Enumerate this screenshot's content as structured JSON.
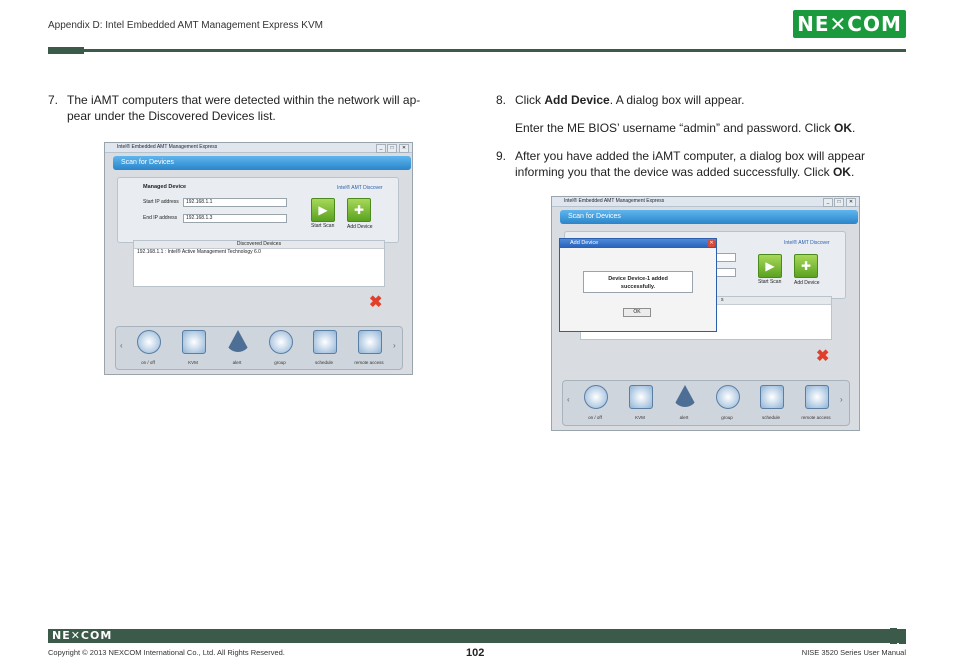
{
  "header": {
    "title": "Appendix D: Intel Embedded AMT Management Express KVM",
    "logo_text": "NE✕COM"
  },
  "steps": {
    "s7_num": "7.",
    "s7_line1": "The iAMT computers that were detected within the network will ap-",
    "s7_line2": "pear under the Discovered Devices list.",
    "s8_num": "8.",
    "s8_pre": "Click ",
    "s8_bold": "Add Device",
    "s8_post": ". A dialog box will appear.",
    "s8b_pre": "Enter the ME BIOS’ username “admin” and password. Click ",
    "s8b_bold": "OK",
    "s8b_post": ".",
    "s9_num": "9.",
    "s9_line1": "After you have added the iAMT computer, a dialog box will appear",
    "s9_line2_pre": "informing you that the device was added successfully. Click ",
    "s9_line2_bold": "OK",
    "s9_line2_post": "."
  },
  "shot1": {
    "window_title": "Intel® Embedded AMT Management Express",
    "bar_label": "Scan for Devices",
    "managed_device": "Managed Device",
    "brand": "Intel® AMT Discover",
    "start_ip_label": "Start IP address",
    "start_ip_value": "192.168.1.1",
    "end_ip_label": "End IP address",
    "end_ip_value": "192.168.1.3",
    "start_scan": "Start Scan",
    "add_device": "Add Device",
    "list_header": "Discovered Devices",
    "list_row": "192.168.1.1 : Intel® Active Management Technology 6.0",
    "dock": [
      "on / off",
      "KVM",
      "alert",
      "group",
      "schedule",
      "remote access"
    ]
  },
  "shot2": {
    "window_title": "Intel® Embedded AMT Management Express",
    "bar_label": "Scan for Devices",
    "brand": "Intel® AMT Discover",
    "start_scan": "Start Scan",
    "add_device": "Add Device",
    "dialog_title": "Add Device",
    "dialog_msg_line1": "Device Device-1 added",
    "dialog_msg_line2": "successfully.",
    "dialog_ok": "OK",
    "list_fragment": "s",
    "dock": [
      "on / off",
      "KVM",
      "alert",
      "group",
      "schedule",
      "remote access"
    ]
  },
  "footer": {
    "logo_text": "NE✕COM",
    "copyright": "Copyright © 2013 NEXCOM International Co., Ltd. All Rights Reserved.",
    "page_number": "102",
    "manual": "NISE 3520 Series User Manual"
  },
  "colors": {
    "brand_green": "#1a9a3c",
    "rule_dark": "#3c5a4a",
    "app_blue": "#2a84c9"
  }
}
